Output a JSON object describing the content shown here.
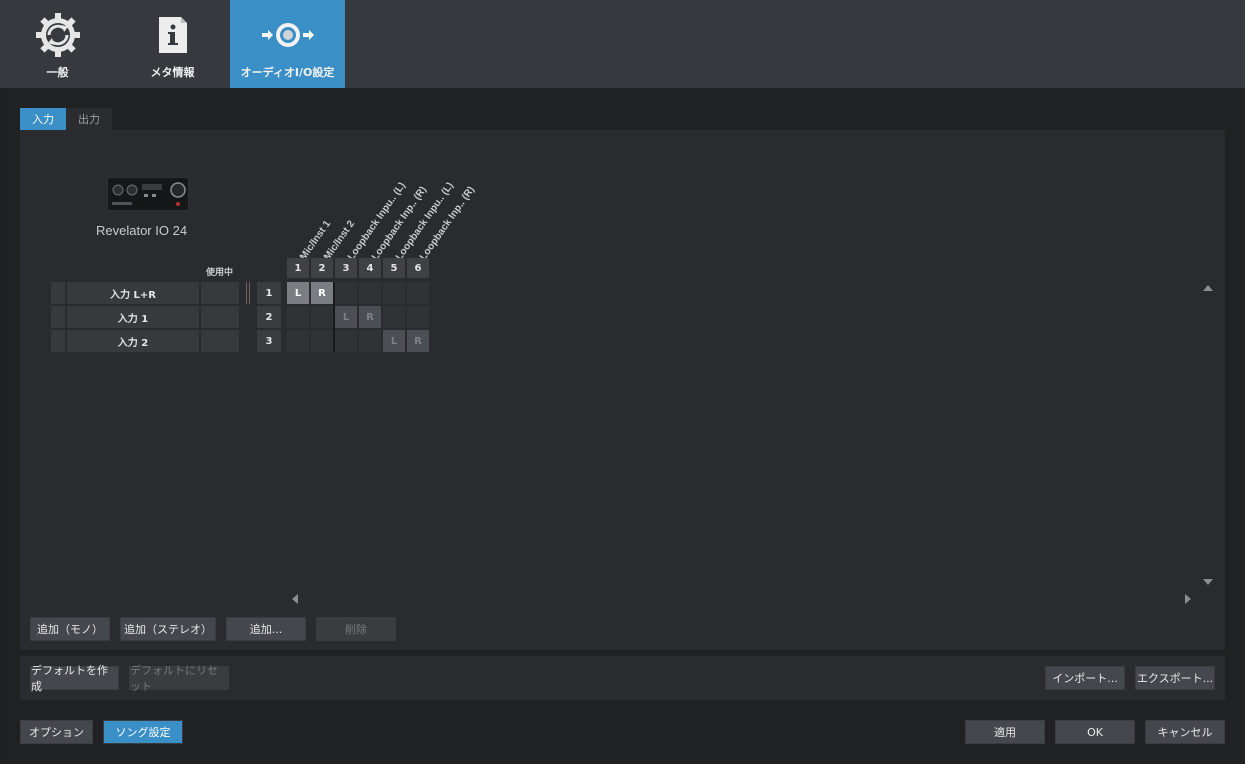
{
  "toolbar": {
    "tabs": [
      {
        "label": "一般",
        "icon": "gear-sync-icon"
      },
      {
        "label": "メタ情報",
        "icon": "info-document-icon"
      },
      {
        "label": "オーディオI/O設定",
        "icon": "audio-io-icon",
        "active": true
      }
    ]
  },
  "subtabs": {
    "input": "入力",
    "output": "出力",
    "active": "input"
  },
  "device": {
    "name": "Revelator IO 24"
  },
  "matrix": {
    "in_use_label": "使用中",
    "columns": [
      {
        "num": "1",
        "label": "Mic/Inst 1"
      },
      {
        "num": "2",
        "label": "Mic/Inst 2"
      },
      {
        "num": "3",
        "label": "Loopback Inpu.. (L)"
      },
      {
        "num": "4",
        "label": "Loopback Inp.. (R)"
      },
      {
        "num": "5",
        "label": "Loopback Inpu.. (L)"
      },
      {
        "num": "6",
        "label": "Loopback Inp.. (R)"
      }
    ],
    "rows": [
      {
        "num": "1",
        "name": "入力 L+R"
      },
      {
        "num": "2",
        "name": "入力 1"
      },
      {
        "num": "3",
        "name": "入力 2"
      }
    ],
    "assignments": [
      {
        "row": 0,
        "col": 0,
        "text": "L",
        "state": "on"
      },
      {
        "row": 0,
        "col": 1,
        "text": "R",
        "state": "on"
      },
      {
        "row": 1,
        "col": 2,
        "text": "L",
        "state": "dim"
      },
      {
        "row": 1,
        "col": 3,
        "text": "R",
        "state": "dim"
      },
      {
        "row": 2,
        "col": 4,
        "text": "L",
        "state": "dim"
      },
      {
        "row": 2,
        "col": 5,
        "text": "R",
        "state": "dim"
      }
    ]
  },
  "buttons": {
    "add_mono": "追加（モノ）",
    "add_stereo": "追加（ステレオ）",
    "add": "追加...",
    "delete": "削除",
    "make_default": "デフォルトを作成",
    "reset_default": "デフォルトにリセット",
    "import": "インポート...",
    "export": "エクスポート...",
    "options": "オプション",
    "song_settings": "ソング設定",
    "apply": "適用",
    "ok": "OK",
    "cancel": "キャンセル"
  },
  "colors": {
    "accent": "#3a8fc7",
    "background": "#202123",
    "panel": "#2a2b2e"
  }
}
